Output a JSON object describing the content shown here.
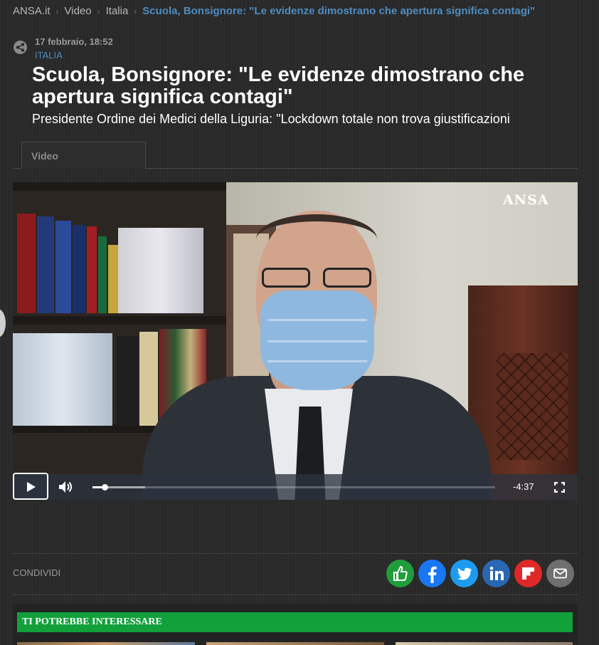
{
  "breadcrumb": {
    "items": [
      "ANSA.it",
      "Video",
      "Italia"
    ],
    "current": "Scuola, Bonsignore: \"Le evidenze dimostrano che apertura significa contagi\""
  },
  "article": {
    "date": "17 febbraio, 18:52",
    "category": "ITALIA",
    "title": "Scuola, Bonsignore: \"Le evidenze dimostrano che apertura significa contagi\"",
    "subtitle": "Presidente Ordine dei Medici della Liguria: \"Lockdown totale non trova giustificazioni"
  },
  "tabs": [
    {
      "label": "Video",
      "active": true
    }
  ],
  "player": {
    "watermark": "ANSA",
    "time_remaining": "-4:37",
    "progress_fraction": 0.03,
    "buffered_fraction": 0.13
  },
  "share": {
    "label": "CONDIVIDI",
    "buttons": [
      "like-icon",
      "facebook-icon",
      "twitter-icon",
      "linkedin-icon",
      "flipboard-icon",
      "email-icon"
    ]
  },
  "recommendations": {
    "title": "TI POTREBBE INTERESSARE"
  },
  "colors": {
    "accent_blue": "#4e8cc0",
    "reco_green": "#12a03b",
    "background": "#2a2a2a"
  }
}
